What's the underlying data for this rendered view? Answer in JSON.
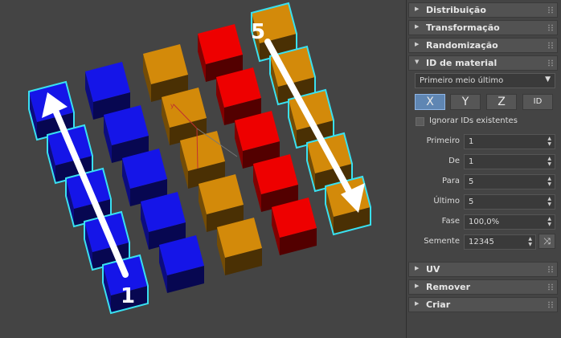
{
  "viewport": {
    "start_label": "1",
    "end_label": "5",
    "colors": {
      "blue": "#1515e8",
      "orange": "#d38a0a",
      "red": "#ee0000",
      "highlight": "#39e0f0",
      "background": "#444444"
    }
  },
  "panel": {
    "rollouts_top": [
      {
        "title": "Distribuição"
      },
      {
        "title": "Transformação"
      },
      {
        "title": "Randomização"
      }
    ],
    "material_id": {
      "title": "ID de material",
      "mode": "Primeiro meio último",
      "axis_buttons": [
        "X",
        "Y",
        "Z",
        "ID"
      ],
      "active_axis": "X",
      "ignore_label": "Ignorar IDs existentes",
      "params": [
        {
          "label": "Primeiro",
          "value": "1"
        },
        {
          "label": "De",
          "value": "1"
        },
        {
          "label": "Para",
          "value": "5"
        },
        {
          "label": "Último",
          "value": "5"
        },
        {
          "label": "Fase",
          "value": "100,0%"
        }
      ],
      "seed_label": "Semente",
      "seed_value": "12345",
      "shuffle_icon": "shuffle-icon"
    },
    "rollouts_bottom": [
      {
        "title": "UV"
      },
      {
        "title": "Remover"
      },
      {
        "title": "Criar"
      }
    ]
  }
}
